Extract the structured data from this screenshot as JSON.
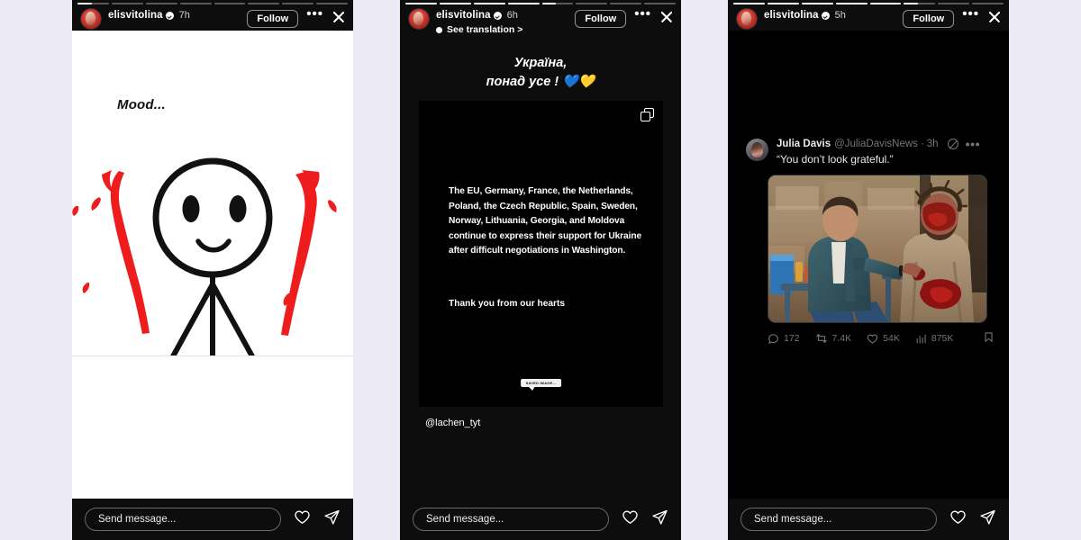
{
  "page": {
    "background_color": "#eceaf4",
    "app": "instagram-stories"
  },
  "stories": [
    {
      "id": "story-1",
      "username": "elisvitolina",
      "verified": true,
      "time": "7h",
      "follow_label": "Follow",
      "more_label": "•••",
      "progress_segments": 8,
      "progress_active_index": 0,
      "progress_active_fill": 45,
      "has_translation": false,
      "translation_label": "",
      "media_type": "drawing",
      "overlay_text": "Mood...",
      "caption": "",
      "footer": {
        "placeholder": "Send message...",
        "like_icon": "heart-icon",
        "share_icon": "send-icon"
      }
    },
    {
      "id": "story-2",
      "username": "elisvitolina",
      "verified": true,
      "time": "6h",
      "follow_label": "Follow",
      "more_label": "•••",
      "progress_segments": 8,
      "progress_active_index": 4,
      "progress_active_fill": 45,
      "has_translation": true,
      "translation_label": "See translation >",
      "media_type": "text-card",
      "title_line1": "Україна,",
      "title_line2": "понад усе ! 💙💛",
      "carousel_icon": "carousel-icon",
      "card_body": "The EU, Germany, France, the Netherlands, Poland, the Czech Republic, Spain, Sweden, Norway, Lithuania, Georgia, and Moldova continue to express their support for Ukraine after difficult negotiations in Washington.",
      "card_thanks": "Thank you from our hearts",
      "watermark": "SAVED IMAGE...",
      "caption": "@lachen_tyt",
      "footer": {
        "placeholder": "Send message...",
        "like_icon": "heart-icon",
        "share_icon": "send-icon"
      }
    },
    {
      "id": "story-3",
      "username": "elisvitolina",
      "verified": true,
      "time": "5h",
      "follow_label": "Follow",
      "more_label": "•••",
      "progress_segments": 8,
      "progress_active_index": 5,
      "progress_active_fill": 45,
      "has_translation": false,
      "translation_label": "",
      "media_type": "tweet-screenshot",
      "tweet": {
        "author_name": "Julia Davis",
        "author_handle": "@JuliaDavisNews",
        "separator": "·",
        "time": "3h",
        "grok_icon": "grok-icon",
        "more_icon": "more-icon",
        "text": "“You don’t look grateful.”",
        "image_alt": "behind-the-scenes photo of two men seated, one in costume with blood makeup and crown of thorns",
        "stats": {
          "reply_icon": "reply-icon",
          "replies": "172",
          "retweet_icon": "retweet-icon",
          "retweets": "7.4K",
          "like_icon": "like-icon",
          "likes": "54K",
          "views_icon": "views-icon",
          "views": "875K",
          "bookmark_icon": "bookmark-icon",
          "share_icon": "share-icon"
        }
      },
      "footer": {
        "placeholder": "Send message...",
        "like_icon": "heart-icon",
        "share_icon": "send-icon"
      }
    }
  ]
}
